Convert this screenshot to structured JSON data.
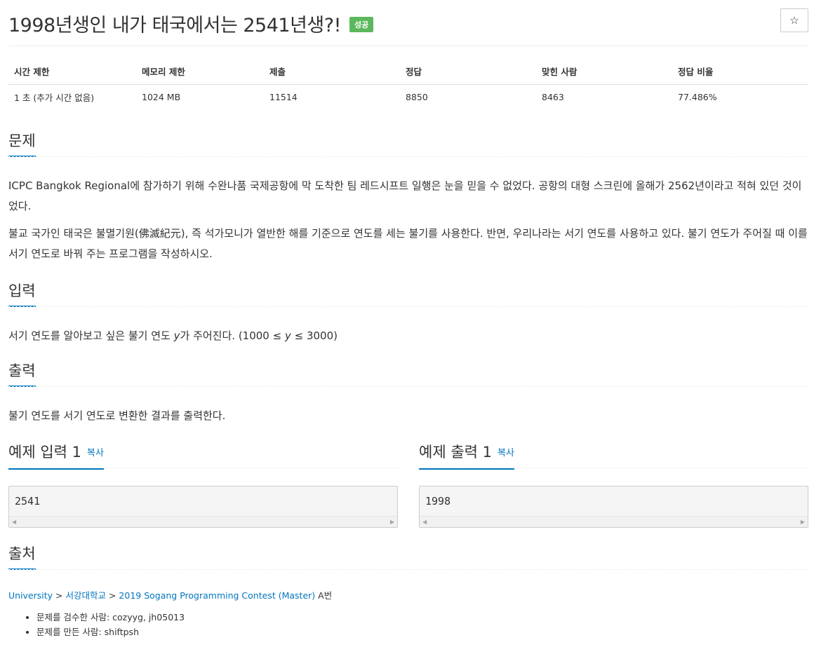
{
  "header": {
    "title": "1998년생인 내가 태국에서는 2541년생?!",
    "badge": "성공",
    "star_icon": "☆"
  },
  "info_table": {
    "headers": [
      "시간 제한",
      "메모리 제한",
      "제출",
      "정답",
      "맞힌 사람",
      "정답 비율"
    ],
    "row": [
      "1 초 (추가 시간 없음)",
      "1024 MB",
      "11514",
      "8850",
      "8463",
      "77.486%"
    ]
  },
  "problem": {
    "heading": "문제",
    "paragraphs": [
      "ICPC Bangkok Regional에 참가하기 위해 수완나품 국제공항에 막 도착한 팀 레드시프트 일행은 눈을 믿을 수 없었다. 공항의 대형 스크린에 올해가 2562년이라고 적혀 있던 것이었다.",
      "불교 국가인 태국은 불멸기원(佛滅紀元), 즉 석가모니가 열반한 해를 기준으로 연도를 세는 불기를 사용한다. 반면, 우리나라는 서기 연도를 사용하고 있다. 불기 연도가 주어질 때 이를 서기 연도로 바꿔 주는 프로그램을 작성하시오."
    ]
  },
  "input": {
    "heading": "입력",
    "text_before": "서기 연도를 알아보고 싶은 불기 연도 ",
    "var": "y",
    "text_mid": "가 주어진다. (1000 ≤ ",
    "var2": "y",
    "text_after": " ≤ 3000)"
  },
  "output": {
    "heading": "출력",
    "text": "불기 연도를 서기 연도로 변환한 결과를 출력한다."
  },
  "samples": {
    "input_heading": "예제 입력 1",
    "output_heading": "예제 출력 1",
    "copy_label": "복사",
    "input_value": "2541",
    "output_value": "1998"
  },
  "source": {
    "heading": "출처",
    "crumb1": "University",
    "sep": " > ",
    "crumb2": "서강대학교",
    "crumb3": "2019 Sogang Programming Contest (Master)",
    "suffix": " A번",
    "credits": [
      "문제를 검수한 사람: cozyyg, jh05013",
      "문제를 만든 사람: shiftpsh"
    ]
  }
}
